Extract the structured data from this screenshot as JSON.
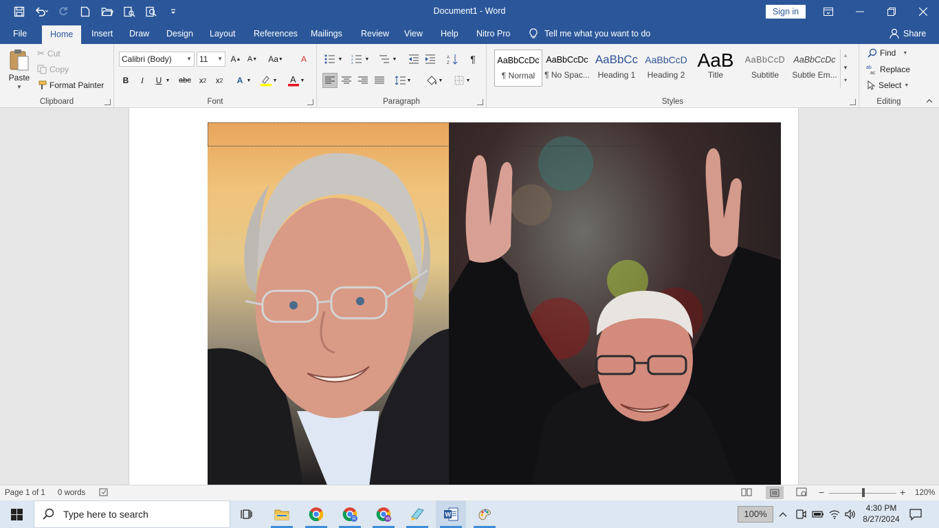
{
  "window": {
    "title": "Document1  -  Word",
    "sign_in": "Sign in"
  },
  "tabs": [
    "File",
    "Home",
    "Insert",
    "Draw",
    "Design",
    "Layout",
    "References",
    "Mailings",
    "Review",
    "View",
    "Help",
    "Nitro Pro"
  ],
  "tell_me": "Tell me what you want to do",
  "share": "Share",
  "clipboard": {
    "paste": "Paste",
    "cut": "Cut",
    "copy": "Copy",
    "format_painter": "Format Painter",
    "label": "Clipboard"
  },
  "font": {
    "name": "Calibri (Body)",
    "size": "11",
    "label": "Font"
  },
  "paragraph": {
    "label": "Paragraph"
  },
  "styles": {
    "items": [
      {
        "preview": "AaBbCcDc",
        "name": "¶ Normal"
      },
      {
        "preview": "AaBbCcDc",
        "name": "¶ No Spac..."
      },
      {
        "preview": "AaBbCc",
        "name": "Heading 1"
      },
      {
        "preview": "AaBbCcD",
        "name": "Heading 2"
      },
      {
        "preview": "AaB",
        "name": "Title"
      },
      {
        "preview": "AaBbCcD",
        "name": "Subtitle"
      },
      {
        "preview": "AaBbCcDc",
        "name": "Subtle Em..."
      }
    ],
    "label": "Styles"
  },
  "editing": {
    "find": "Find",
    "replace": "Replace",
    "select": "Select",
    "label": "Editing"
  },
  "status": {
    "page": "Page 1 of 1",
    "words": "0 words",
    "zoom": "120%"
  },
  "taskbar": {
    "search_placeholder": "Type here to search",
    "zoom_badge": "100%",
    "time": "4:30 PM",
    "date": "8/27/2024"
  },
  "colors": {
    "word_blue": "#2b579a",
    "ribbon_bg": "#f3f3f3",
    "highlight_yellow": "#ffff00",
    "font_color_red": "#e81123"
  }
}
